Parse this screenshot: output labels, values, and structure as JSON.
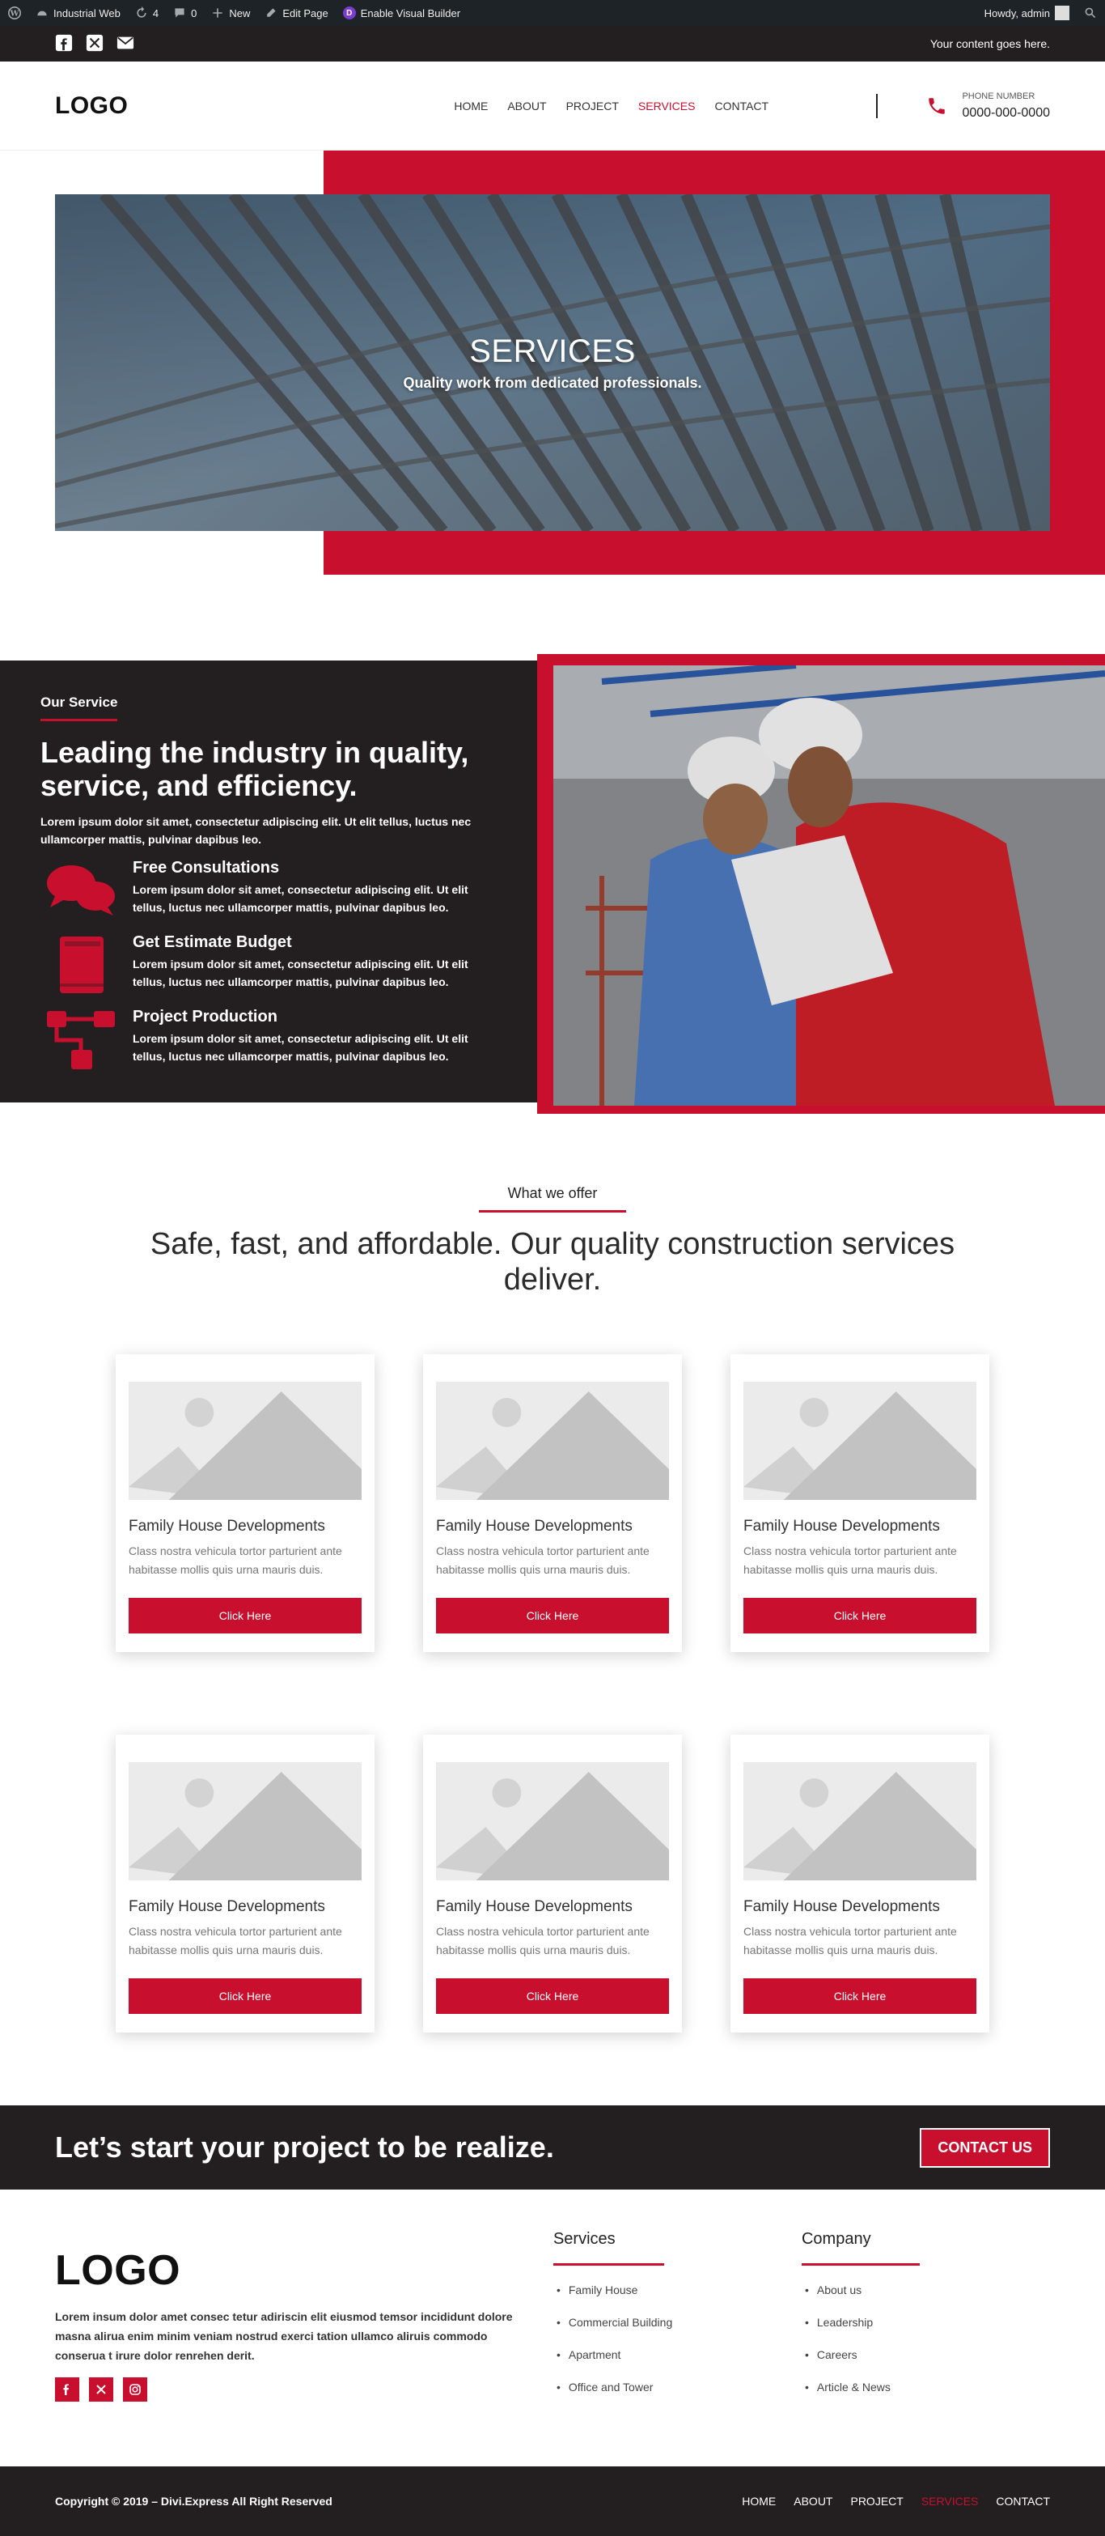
{
  "adminbar": {
    "site": "Industrial Web",
    "updates": "4",
    "comments": "0",
    "new": "New",
    "edit": "Edit Page",
    "builder": "Enable Visual Builder",
    "howdy": "Howdy, admin"
  },
  "topbar": {
    "message": "Your content goes here."
  },
  "header": {
    "logo": "LOGO",
    "nav": [
      "HOME",
      "ABOUT",
      "PROJECT",
      "SERVICES",
      "CONTACT"
    ],
    "active": "SERVICES",
    "phone_label": "PHONE NUMBER",
    "phone_number": "0000-000-0000"
  },
  "hero": {
    "title": "SERVICES",
    "subtitle": "Quality work from dedicated professionals."
  },
  "service": {
    "eyebrow": "Our Service",
    "title": "Leading the industry in quality, service, and efficiency.",
    "lead": "Lorem ipsum dolor sit amet, consectetur adipiscing elit. Ut elit tellus, luctus nec ullamcorper mattis, pulvinar dapibus leo.",
    "features": [
      {
        "title": "Free Consultations",
        "text": "Lorem ipsum dolor sit amet, consectetur adipiscing elit. Ut elit tellus, luctus nec ullamcorper mattis, pulvinar dapibus leo.",
        "icon": "chat-bubbles-icon"
      },
      {
        "title": "Get Estimate Budget",
        "text": "Lorem ipsum dolor sit amet, consectetur adipiscing elit. Ut elit tellus, luctus nec ullamcorper mattis, pulvinar dapibus leo.",
        "icon": "book-icon"
      },
      {
        "title": "Project Production",
        "text": "Lorem ipsum dolor sit amet, consectetur adipiscing elit. Ut elit tellus, luctus nec ullamcorper mattis, pulvinar dapibus leo.",
        "icon": "sitemap-icon"
      }
    ]
  },
  "offer": {
    "eyebrow": "What we offer",
    "title": "Safe, fast, and affordable. Our quality construction services deliver.",
    "cards": [
      {
        "title": "Family House Developments",
        "text": "Class nostra vehicula tortor parturient ante habitasse mollis quis urna mauris duis.",
        "button": "Click Here"
      },
      {
        "title": "Family House Developments",
        "text": "Class nostra vehicula tortor parturient ante habitasse mollis quis urna mauris duis.",
        "button": "Click Here"
      },
      {
        "title": "Family House Developments",
        "text": "Class nostra vehicula tortor parturient ante habitasse mollis quis urna mauris duis.",
        "button": "Click Here"
      },
      {
        "title": "Family House Developments",
        "text": "Class nostra vehicula tortor parturient ante habitasse mollis quis urna mauris duis.",
        "button": "Click Here"
      },
      {
        "title": "Family House Developments",
        "text": "Class nostra vehicula tortor parturient ante habitasse mollis quis urna mauris duis.",
        "button": "Click Here"
      },
      {
        "title": "Family House Developments",
        "text": "Class nostra vehicula tortor parturient ante habitasse mollis quis urna mauris duis.",
        "button": "Click Here"
      }
    ]
  },
  "cta": {
    "title": "Let’s start your project to be realize.",
    "button": "CONTACT US"
  },
  "footer": {
    "logo": "LOGO",
    "desc": "Lorem insum dolor amet consec tetur adiriscin elit eiusmod temsor incididunt dolore masna alirua enim minim veniam nostrud exerci tation ullamco aliruis commodo conserua t irure dolor renrehen derit.",
    "services_title": "Services",
    "services": [
      "Family House",
      "Commercial Building",
      "Apartment",
      "Office and Tower"
    ],
    "company_title": "Company",
    "company": [
      "About us",
      "Leadership",
      "Careers",
      "Article & News"
    ]
  },
  "bottom": {
    "copyright": "Copyright © 2019 – Divi.Express All Right Reserved",
    "nav": [
      "HOME",
      "ABOUT",
      "PROJECT",
      "SERVICES",
      "CONTACT"
    ],
    "active": "SERVICES"
  },
  "colors": {
    "accent": "#c8102e",
    "dark": "#231f20",
    "adminbar": "#1d2327"
  }
}
